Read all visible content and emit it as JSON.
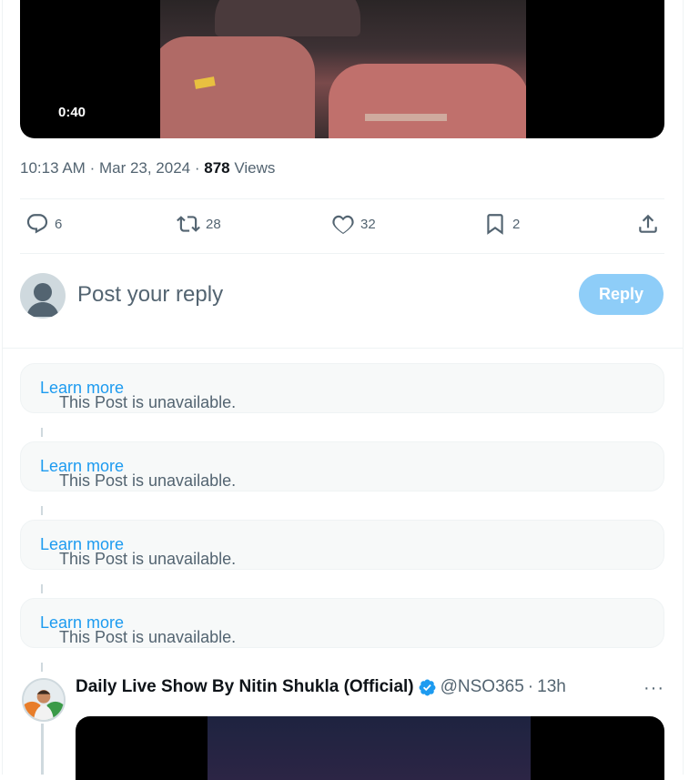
{
  "video": {
    "duration": "0:40"
  },
  "post_meta": {
    "time": "10:13 AM",
    "date": "Mar 23, 2024",
    "views_count": "878",
    "views_label": "Views"
  },
  "actions": {
    "replies": "6",
    "reposts": "28",
    "likes": "32",
    "bookmarks": "2"
  },
  "reply_box": {
    "placeholder": "Post your reply",
    "button": "Reply"
  },
  "unavailable": [
    {
      "text": "This Post is unavailable.",
      "link": "Learn more"
    },
    {
      "text": "This Post is unavailable.",
      "link": "Learn more"
    },
    {
      "text": "This Post is unavailable.",
      "link": "Learn more"
    },
    {
      "text": "This Post is unavailable.",
      "link": "Learn more"
    }
  ],
  "reply_tweet": {
    "name": "Daily Live Show By Nitin Shukla (Official)",
    "handle": "@NSO365",
    "time": "13h",
    "more": "···"
  },
  "colors": {
    "accent": "#1d9bf0",
    "reply_button": "#8ecdf8",
    "muted": "#536471",
    "verified": "#1d9bf0"
  }
}
